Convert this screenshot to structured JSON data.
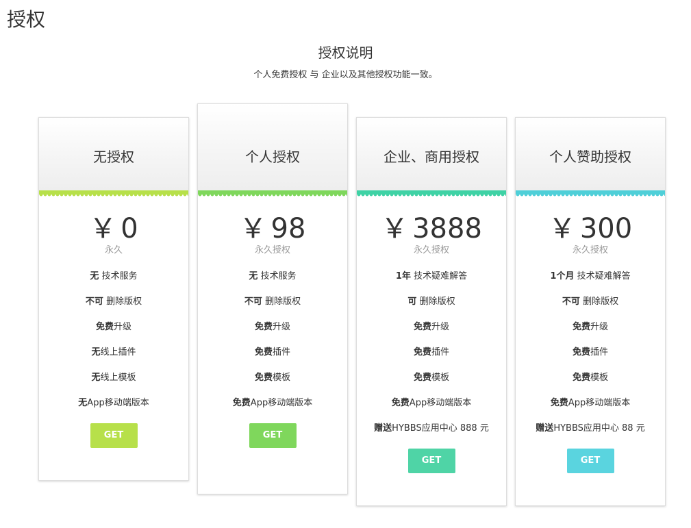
{
  "page": {
    "heading": "授权"
  },
  "section": {
    "title": "授权说明",
    "description": "个人免费授权 与 企业以及其他授权功能一致。"
  },
  "colors": {
    "plan1": "#b7e04a",
    "plan2": "#7fd75c",
    "plan3": "#3fd2a5",
    "plan4": "#4fcfd8"
  },
  "plans": [
    {
      "title": "无授权",
      "currency": "￥",
      "price": "0",
      "price_note": "永久",
      "features": [
        {
          "strong": "无",
          "text": " 技术服务"
        },
        {
          "strong": "不可",
          "text": " 删除版权"
        },
        {
          "strong": "免费",
          "text": "升级"
        },
        {
          "strong": "无",
          "text": "线上插件"
        },
        {
          "strong": "无",
          "text": "线上模板"
        },
        {
          "strong": "无",
          "text": "App移动端版本"
        }
      ],
      "button": "GET"
    },
    {
      "title": "个人授权",
      "currency": "￥",
      "price": "98",
      "price_note": "永久授权",
      "features": [
        {
          "strong": "无",
          "text": " 技术服务"
        },
        {
          "strong": "不可",
          "text": " 删除版权"
        },
        {
          "strong": "免费",
          "text": "升级"
        },
        {
          "strong": "免费",
          "text": "插件"
        },
        {
          "strong": "免费",
          "text": "模板"
        },
        {
          "strong": "免费",
          "text": "App移动端版本"
        }
      ],
      "button": "GET"
    },
    {
      "title": "企业、商用授权",
      "currency": "￥",
      "price": "3888",
      "price_note": "永久授权",
      "features": [
        {
          "strong": "1年",
          "text": " 技术疑难解答"
        },
        {
          "strong": "可",
          "text": " 删除版权"
        },
        {
          "strong": "免费",
          "text": "升级"
        },
        {
          "strong": "免费",
          "text": "插件"
        },
        {
          "strong": "免费",
          "text": "模板"
        },
        {
          "strong": "免费",
          "text": "App移动端版本"
        },
        {
          "strong": "赠送",
          "text": "HYBBS应用中心 888 元"
        }
      ],
      "button": "GET"
    },
    {
      "title": "个人赞助授权",
      "currency": "￥",
      "price": "300",
      "price_note": "永久授权",
      "features": [
        {
          "strong": "1个月",
          "text": " 技术疑难解答"
        },
        {
          "strong": "不可",
          "text": " 删除版权"
        },
        {
          "strong": "免费",
          "text": "升级"
        },
        {
          "strong": "免费",
          "text": "插件"
        },
        {
          "strong": "免费",
          "text": "模板"
        },
        {
          "strong": "免费",
          "text": "App移动端版本"
        },
        {
          "strong": "赠送",
          "text": "HYBBS应用中心 88 元"
        }
      ],
      "button": "GET"
    }
  ]
}
